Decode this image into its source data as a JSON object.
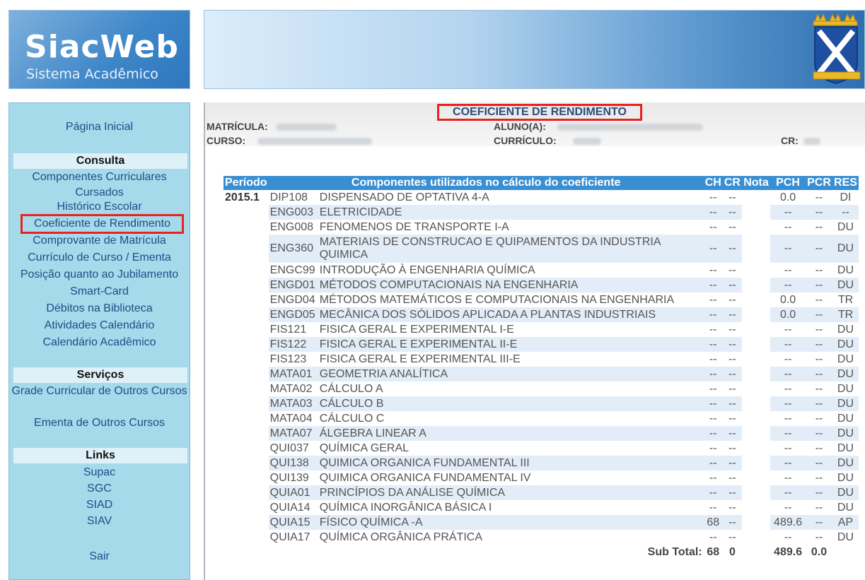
{
  "header": {
    "logo_title": "SiacWeb",
    "logo_subtitle": "Sistema Acadêmico"
  },
  "sidebar": {
    "home": "Página Inicial",
    "consulta": {
      "title": "Consulta",
      "items": [
        "Componentes Curriculares Cursados",
        "Histórico Escolar",
        "Coeficiente de Rendimento",
        "Comprovante de Matrícula",
        "Currículo de Curso / Ementa",
        "Posição quanto ao Jubilamento",
        "Smart-Card",
        "Débitos na Biblioteca",
        "Atividades Calendário",
        "Calendário Acadêmico"
      ]
    },
    "servicos": {
      "title": "Serviços",
      "items": [
        "Grade Curricular de Outros Cursos",
        "Ementa de Outros Cursos"
      ]
    },
    "links": {
      "title": "Links",
      "items": [
        "Supac",
        "SGC",
        "SIAD",
        "SIAV"
      ]
    },
    "logout": "Sair"
  },
  "main": {
    "title": "COEFICIENTE DE RENDIMENTO",
    "labels": {
      "matricula": "MATRÍCULA:",
      "aluno": "ALUNO(A):",
      "curso": "CURSO:",
      "curriculo": "CURRÍCULO:",
      "cr": "CR:"
    },
    "table": {
      "headers": [
        "Período",
        "Componentes utilizados no cálculo do coeficiente",
        "CH",
        "CR",
        "Nota",
        "PCH",
        "PCR",
        "RES"
      ],
      "rows": [
        {
          "periodo": "2015.1",
          "code": "DIP108",
          "name": "DISPENSADO DE OPTATIVA 4-A",
          "ch": "--",
          "cr": "--",
          "nota": "",
          "pch": "0.0",
          "pcr": "--",
          "res": "DI"
        },
        {
          "periodo": "",
          "code": "ENG003",
          "name": "ELETRICIDADE",
          "ch": "--",
          "cr": "--",
          "nota": "",
          "pch": "--",
          "pcr": "--",
          "res": "--"
        },
        {
          "periodo": "",
          "code": "ENG008",
          "name": "FENOMENOS DE TRANSPORTE I-A",
          "ch": "--",
          "cr": "--",
          "nota": "",
          "pch": "--",
          "pcr": "--",
          "res": "DU"
        },
        {
          "periodo": "",
          "code": "ENG360",
          "name": "MATERIAIS DE CONSTRUCAO E QUIPAMENTOS DA INDUSTRIA QUIMICA",
          "ch": "--",
          "cr": "--",
          "nota": "",
          "pch": "--",
          "pcr": "--",
          "res": "DU"
        },
        {
          "periodo": "",
          "code": "ENGC99",
          "name": "INTRODUÇÃO À ENGENHARIA QUÍMICA",
          "ch": "--",
          "cr": "--",
          "nota": "",
          "pch": "--",
          "pcr": "--",
          "res": "DU"
        },
        {
          "periodo": "",
          "code": "ENGD01",
          "name": "MÉTODOS COMPUTACIONAIS NA ENGENHARIA",
          "ch": "--",
          "cr": "--",
          "nota": "",
          "pch": "--",
          "pcr": "--",
          "res": "DU"
        },
        {
          "periodo": "",
          "code": "ENGD04",
          "name": "MÉTODOS MATEMÁTICOS E COMPUTACIONAIS NA ENGENHARIA",
          "ch": "--",
          "cr": "--",
          "nota": "",
          "pch": "0.0",
          "pcr": "--",
          "res": "TR"
        },
        {
          "periodo": "",
          "code": "ENGD05",
          "name": "MECÂNICA DOS SÓLIDOS APLICADA A PLANTAS INDUSTRIAIS",
          "ch": "--",
          "cr": "--",
          "nota": "",
          "pch": "0.0",
          "pcr": "--",
          "res": "TR"
        },
        {
          "periodo": "",
          "code": "FIS121",
          "name": "FISICA GERAL E EXPERIMENTAL I-E",
          "ch": "--",
          "cr": "--",
          "nota": "",
          "pch": "--",
          "pcr": "--",
          "res": "DU"
        },
        {
          "periodo": "",
          "code": "FIS122",
          "name": "FISICA GERAL E EXPERIMENTAL II-E",
          "ch": "--",
          "cr": "--",
          "nota": "",
          "pch": "--",
          "pcr": "--",
          "res": "DU"
        },
        {
          "periodo": "",
          "code": "FIS123",
          "name": "FISICA GERAL E EXPERIMENTAL III-E",
          "ch": "--",
          "cr": "--",
          "nota": "",
          "pch": "--",
          "pcr": "--",
          "res": "DU"
        },
        {
          "periodo": "",
          "code": "MATA01",
          "name": "GEOMETRIA ANALÍTICA",
          "ch": "--",
          "cr": "--",
          "nota": "",
          "pch": "--",
          "pcr": "--",
          "res": "DU"
        },
        {
          "periodo": "",
          "code": "MATA02",
          "name": "CÁLCULO A",
          "ch": "--",
          "cr": "--",
          "nota": "",
          "pch": "--",
          "pcr": "--",
          "res": "DU"
        },
        {
          "periodo": "",
          "code": "MATA03",
          "name": "CÁLCULO B",
          "ch": "--",
          "cr": "--",
          "nota": "",
          "pch": "--",
          "pcr": "--",
          "res": "DU"
        },
        {
          "periodo": "",
          "code": "MATA04",
          "name": "CÁLCULO C",
          "ch": "--",
          "cr": "--",
          "nota": "",
          "pch": "--",
          "pcr": "--",
          "res": "DU"
        },
        {
          "periodo": "",
          "code": "MATA07",
          "name": "ÁLGEBRA LINEAR A",
          "ch": "--",
          "cr": "--",
          "nota": "",
          "pch": "--",
          "pcr": "--",
          "res": "DU"
        },
        {
          "periodo": "",
          "code": "QUI037",
          "name": "QUÍMICA GERAL",
          "ch": "--",
          "cr": "--",
          "nota": "",
          "pch": "--",
          "pcr": "--",
          "res": "DU"
        },
        {
          "periodo": "",
          "code": "QUI138",
          "name": "QUIMICA ORGANICA FUNDAMENTAL III",
          "ch": "--",
          "cr": "--",
          "nota": "",
          "pch": "--",
          "pcr": "--",
          "res": "DU"
        },
        {
          "periodo": "",
          "code": "QUI139",
          "name": "QUIMICA ORGANICA FUNDAMENTAL IV",
          "ch": "--",
          "cr": "--",
          "nota": "",
          "pch": "--",
          "pcr": "--",
          "res": "DU"
        },
        {
          "periodo": "",
          "code": "QUIA01",
          "name": "PRINCÍPIOS DA ANÁLISE QUÍMICA",
          "ch": "--",
          "cr": "--",
          "nota": "",
          "pch": "--",
          "pcr": "--",
          "res": "DU"
        },
        {
          "periodo": "",
          "code": "QUIA14",
          "name": "QUÍMICA INORGÂNICA BÁSICA I",
          "ch": "--",
          "cr": "--",
          "nota": "",
          "pch": "--",
          "pcr": "--",
          "res": "DU"
        },
        {
          "periodo": "",
          "code": "QUIA15",
          "name": "FÍSICO QUÍMICA -A",
          "ch": "68",
          "cr": "--",
          "nota": "",
          "pch": "489.6",
          "pcr": "--",
          "res": "AP"
        },
        {
          "periodo": "",
          "code": "QUIA17",
          "name": "QUÍMICA ORGÂNICA PRÁTICA",
          "ch": "--",
          "cr": "--",
          "nota": "",
          "pch": "--",
          "pcr": "--",
          "res": "DU"
        }
      ],
      "subtotal": {
        "label": "Sub Total:",
        "ch": "68",
        "cr": "0",
        "pch": "489.6",
        "pcr": "0.0"
      }
    }
  },
  "colors": {
    "sidebar_bg": "#a6d9ea",
    "table_header_bg": "#3a8fd3",
    "row_alt_bg": "#e3edf8",
    "highlight": "#e8231f",
    "link": "#1b4f86"
  }
}
